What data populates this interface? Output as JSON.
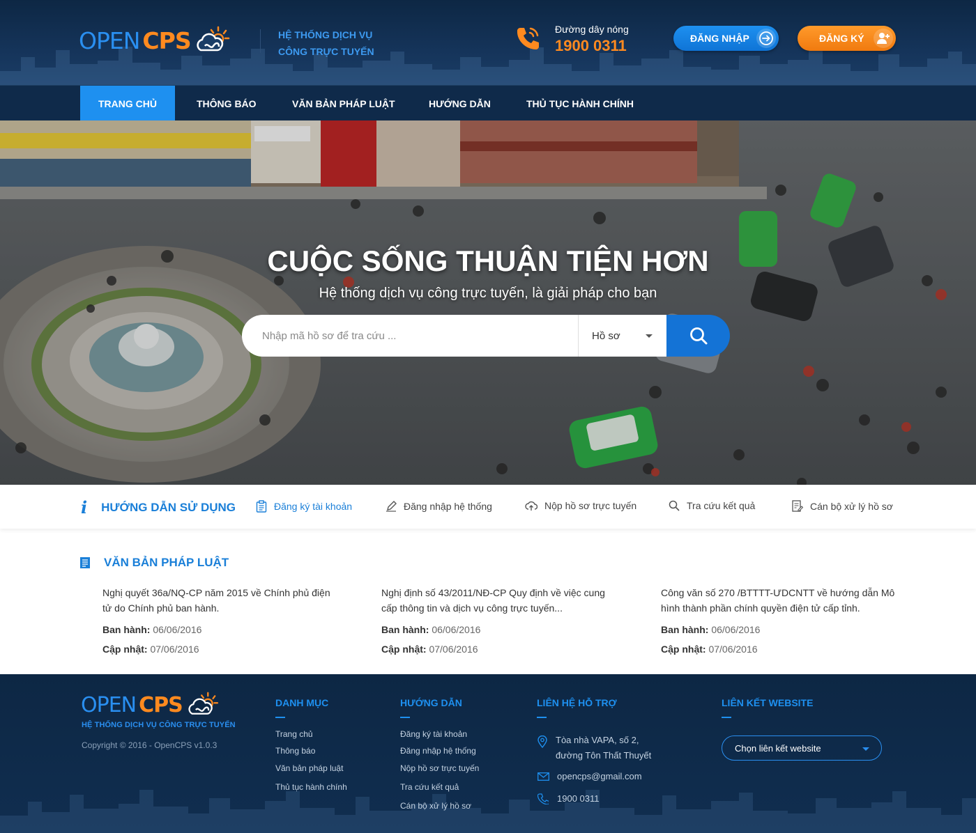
{
  "header": {
    "logo_open": "OPEN",
    "logo_cps": "CPS",
    "tagline_line1": "HỆ THỐNG DỊCH VỤ",
    "tagline_line2": "CÔNG TRỰC TUYẾN",
    "hotline_label": "Đường dây nóng",
    "hotline_number": "1900 0311",
    "login_label": "ĐĂNG NHẬP",
    "register_label": "ĐĂNG KÝ"
  },
  "nav": {
    "items": [
      {
        "label": "TRANG CHỦ",
        "active": true
      },
      {
        "label": "THÔNG BÁO"
      },
      {
        "label": "VĂN BẢN PHÁP LUẬT"
      },
      {
        "label": "HƯỚNG DẪN"
      },
      {
        "label": "THỦ TỤC HÀNH CHÍNH"
      }
    ]
  },
  "hero": {
    "title": "CUỘC SỐNG THUẬN TIỆN HƠN",
    "subtitle": "Hệ thống dịch vụ công trực tuyến, là giải pháp cho bạn",
    "search_placeholder": "Nhập mã hồ sơ để tra cứu ...",
    "search_type": "Hồ sơ"
  },
  "guide": {
    "title": "HƯỚNG DẪN SỬ DỤNG",
    "items": [
      {
        "label": "Đăng ký tài khoản",
        "icon": "clipboard-icon"
      },
      {
        "label": "Đăng nhập hệ thống",
        "icon": "pencil-icon"
      },
      {
        "label": "Nộp hồ sơ trực tuyến",
        "icon": "cloud-upload-icon"
      },
      {
        "label": "Tra cứu kết quả",
        "icon": "search-icon"
      },
      {
        "label": "Cán bộ xử lý hồ sơ",
        "icon": "document-edit-icon"
      }
    ]
  },
  "law": {
    "title": "VĂN BẢN PHÁP LUẬT",
    "issued_label": "Ban hành:",
    "updated_label": "Cập nhật:",
    "docs": [
      {
        "title": "Nghị quyết 36a/NQ-CP năm 2015 về Chính phủ điện tử do Chính phủ ban hành.",
        "issued": "06/06/2016",
        "updated": "07/06/2016"
      },
      {
        "title": "Nghị định số 43/2011/NĐ-CP Quy định về việc cung cấp thông tin và dịch vụ công trực tuyến...",
        "issued": "06/06/2016",
        "updated": "07/06/2016"
      },
      {
        "title": "Công văn số 270 /BTTTT-ƯDCNTT về hướng dẫn Mô hình thành phần chính quyền điện tử cấp tỉnh.",
        "issued": "06/06/2016",
        "updated": "07/06/2016"
      }
    ]
  },
  "footer": {
    "tagline": "HỆ THỐNG DỊCH VỤ CÔNG TRỰC TUYẾN",
    "copyright": "Copyright © 2016 - OpenCPS v1.0.3",
    "categories_title": "DANH MỤC",
    "categories": [
      "Trang chủ",
      "Thông báo",
      "Văn bản pháp luật",
      "Thủ tục hành chính"
    ],
    "guides_title": "HƯỚNG DẪN",
    "guides": [
      "Đăng ký tài khoản",
      "Đăng nhập hệ thống",
      "Nộp hồ sơ trực tuyến",
      "Tra cứu kết quả",
      "Cán bộ xử lý hồ sơ"
    ],
    "support_title": "LIÊN HỆ HỖ TRỢ",
    "address_line1": "Tòa nhà VAPA, số 2,",
    "address_line2": "đường Tôn Thất Thuyết",
    "email": "opencps@gmail.com",
    "phone": "1900 0311",
    "links_title": "LIÊN KẾT WEBSITE",
    "links_select": "Chọn liên kết website"
  },
  "colors": {
    "primary_blue": "#1e90f0",
    "accent_orange": "#ff8a1f",
    "navy": "#0f2a4a"
  }
}
